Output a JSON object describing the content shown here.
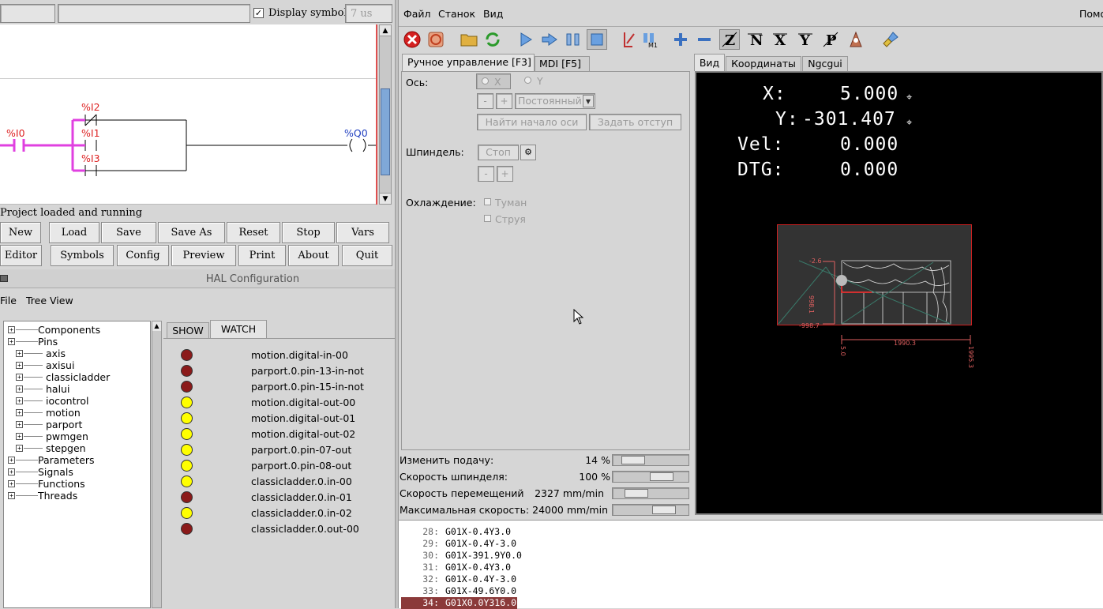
{
  "ladder": {
    "top_input_value": "7 us",
    "display_symbols_label": "Display symbols",
    "contacts": [
      "%I2",
      "%I1",
      "%I3",
      "%I0"
    ],
    "coil": "%Q0",
    "status": "Project loaded and running",
    "buttons_row1": [
      "New",
      "Load",
      "Save",
      "Save As",
      "Reset",
      "Stop",
      "Vars"
    ],
    "buttons_row2": [
      "Editor",
      "Symbols",
      "Config",
      "Preview",
      "Print",
      "About",
      "Quit"
    ]
  },
  "hal": {
    "title": "HAL Configuration",
    "menu": [
      "File",
      "Tree View"
    ],
    "tabs": [
      "SHOW",
      "WATCH"
    ],
    "tree": [
      {
        "label": "Components",
        "level": 0
      },
      {
        "label": "Pins",
        "level": 0
      },
      {
        "label": "axis",
        "level": 1
      },
      {
        "label": "axisui",
        "level": 1
      },
      {
        "label": "classicladder",
        "level": 1
      },
      {
        "label": "halui",
        "level": 1
      },
      {
        "label": "iocontrol",
        "level": 1
      },
      {
        "label": "motion",
        "level": 1
      },
      {
        "label": "parport",
        "level": 1
      },
      {
        "label": "pwmgen",
        "level": 1
      },
      {
        "label": "stepgen",
        "level": 1
      },
      {
        "label": "Parameters",
        "level": 0
      },
      {
        "label": "Signals",
        "level": 0
      },
      {
        "label": "Functions",
        "level": 0
      },
      {
        "label": "Threads",
        "level": 0
      }
    ],
    "watch": [
      {
        "pin": "motion.digital-in-00",
        "state": "off"
      },
      {
        "pin": "parport.0.pin-13-in-not",
        "state": "off"
      },
      {
        "pin": "parport.0.pin-15-in-not",
        "state": "off"
      },
      {
        "pin": "motion.digital-out-00",
        "state": "on"
      },
      {
        "pin": "motion.digital-out-01",
        "state": "on"
      },
      {
        "pin": "motion.digital-out-02",
        "state": "on"
      },
      {
        "pin": "parport.0.pin-07-out",
        "state": "on"
      },
      {
        "pin": "parport.0.pin-08-out",
        "state": "on"
      },
      {
        "pin": "classicladder.0.in-00",
        "state": "on"
      },
      {
        "pin": "classicladder.0.in-01",
        "state": "off"
      },
      {
        "pin": "classicladder.0.in-02",
        "state": "on"
      },
      {
        "pin": "classicladder.0.out-00",
        "state": "off"
      }
    ],
    "colors": {
      "on": "#ffff00",
      "off": "#8b1a1a"
    }
  },
  "axis": {
    "menu": [
      "Файл",
      "Станок",
      "Вид"
    ],
    "menu_right": "Помо",
    "tabs_left": [
      "Ручное управление [F3]",
      "MDI [F5]"
    ],
    "axis_label": "Ось:",
    "axis_options": [
      "X",
      "Y"
    ],
    "minus": "-",
    "plus": "+",
    "jog_mode": "Постоянный",
    "home_button": "Найти начало оси",
    "offset_button": "Задать отступ",
    "spindle_label": "Шпиндель:",
    "spindle_stop": "Стоп",
    "coolant_label": "Охлаждение:",
    "coolant_mist": "Туман",
    "coolant_flood": "Струя",
    "tabs_right": [
      "Вид",
      "Координаты",
      "Ngcgui"
    ],
    "dro": {
      "x_label": "X:",
      "x_value": "5.000",
      "y_label": "Y:",
      "y_value": "-301.407",
      "vel_label": "Vel:",
      "vel_value": "0.000",
      "dtg_label": "DTG:",
      "dtg_value": "0.000"
    },
    "preview_labels": {
      "y_top": "-2.6",
      "y_mid": "998.1",
      "y_bottom": "-998.7",
      "x_left": "5.0",
      "x_width": "1990.3",
      "x_right": "1995.3"
    },
    "overrides": [
      {
        "label": "Изменить подачу:",
        "value": "14 %",
        "fraction": 0.14
      },
      {
        "label": "Скорость шпинделя:",
        "value": "100 %",
        "fraction": 0.7
      },
      {
        "label": "Скорость перемещений",
        "value": "2327 mm/min",
        "fraction": 0.2
      },
      {
        "label": "Максимальная скорость:",
        "value": "24000 mm/min",
        "fraction": 0.75
      }
    ],
    "gcode": [
      {
        "num": "28:",
        "text": "G01X-0.4Y3.0"
      },
      {
        "num": "29:",
        "text": "G01X-0.4Y-3.0"
      },
      {
        "num": "30:",
        "text": "G01X-391.9Y0.0"
      },
      {
        "num": "31:",
        "text": "G01X-0.4Y3.0"
      },
      {
        "num": "32:",
        "text": "G01X-0.4Y-3.0"
      },
      {
        "num": "33:",
        "text": "G01X-49.6Y0.0"
      },
      {
        "num": "34:",
        "text": "G01X0.0Y316.0"
      }
    ],
    "active_line_color": "#8b3a3a"
  }
}
